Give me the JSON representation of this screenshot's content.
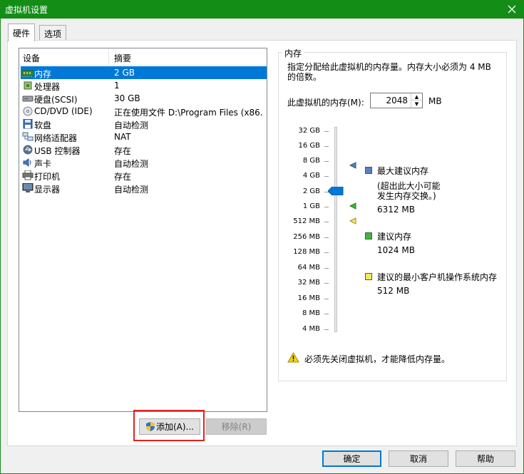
{
  "window": {
    "title": "虚拟机设置"
  },
  "tabs": [
    {
      "label": "硬件"
    },
    {
      "label": "选项"
    }
  ],
  "device_list": {
    "headers": {
      "device": "设备",
      "summary": "摘要"
    },
    "rows": [
      {
        "name": "内存",
        "summary": "2 GB",
        "icon": "memory-icon",
        "selected": true
      },
      {
        "name": "处理器",
        "summary": "1",
        "icon": "cpu-icon"
      },
      {
        "name": "硬盘(SCSI)",
        "summary": "30 GB",
        "icon": "hard-disk-icon"
      },
      {
        "name": "CD/DVD (IDE)",
        "summary": "正在使用文件 D:\\Program Files (x86...",
        "icon": "cd-dvd-icon"
      },
      {
        "name": "软盘",
        "summary": "自动检测",
        "icon": "floppy-icon"
      },
      {
        "name": "网络适配器",
        "summary": "NAT",
        "icon": "network-adapter-icon"
      },
      {
        "name": "USB 控制器",
        "summary": "存在",
        "icon": "usb-icon"
      },
      {
        "name": "声卡",
        "summary": "自动检测",
        "icon": "sound-card-icon"
      },
      {
        "name": "打印机",
        "summary": "存在",
        "icon": "printer-icon"
      },
      {
        "name": "显示器",
        "summary": "自动检测",
        "icon": "display-icon"
      }
    ]
  },
  "buttons": {
    "add": "添加(A)...",
    "remove": "移除(R)",
    "ok": "确定",
    "cancel": "取消",
    "help": "帮助"
  },
  "memory": {
    "group_title": "内存",
    "description": "指定分配给此虚拟机的内存量。内存大小必须为 4 MB 的倍数。",
    "field_label": "此虚拟机的内存(M):",
    "value": "2048",
    "unit": "MB",
    "scale": [
      "32 GB",
      "16 GB",
      "8 GB",
      "4 GB",
      "2 GB",
      "1 GB",
      "512 MB",
      "256 MB",
      "128 MB",
      "64 MB",
      "32 MB",
      "16 MB",
      "8 MB",
      "4 MB"
    ],
    "current_level": "2 GB",
    "legend": {
      "max": {
        "label": "最大建议内存",
        "note_line1": "(超出此大小可能",
        "note_line2": "发生内存交换。)",
        "value": "6312 MB",
        "color": "#5b7fbf"
      },
      "recommended": {
        "label": "建议内存",
        "value": "1024 MB",
        "color": "#3cb93c"
      },
      "min_guest": {
        "label": "建议的最小客户机操作系统内存",
        "value": "512 MB",
        "color": "#f2ea5a"
      }
    },
    "warning": "必须先关闭虚拟机，才能降低内存量。"
  },
  "colors": {
    "title_bar": "#138d16",
    "selection": "#0078d7",
    "highlight_box": "#e0231f"
  }
}
